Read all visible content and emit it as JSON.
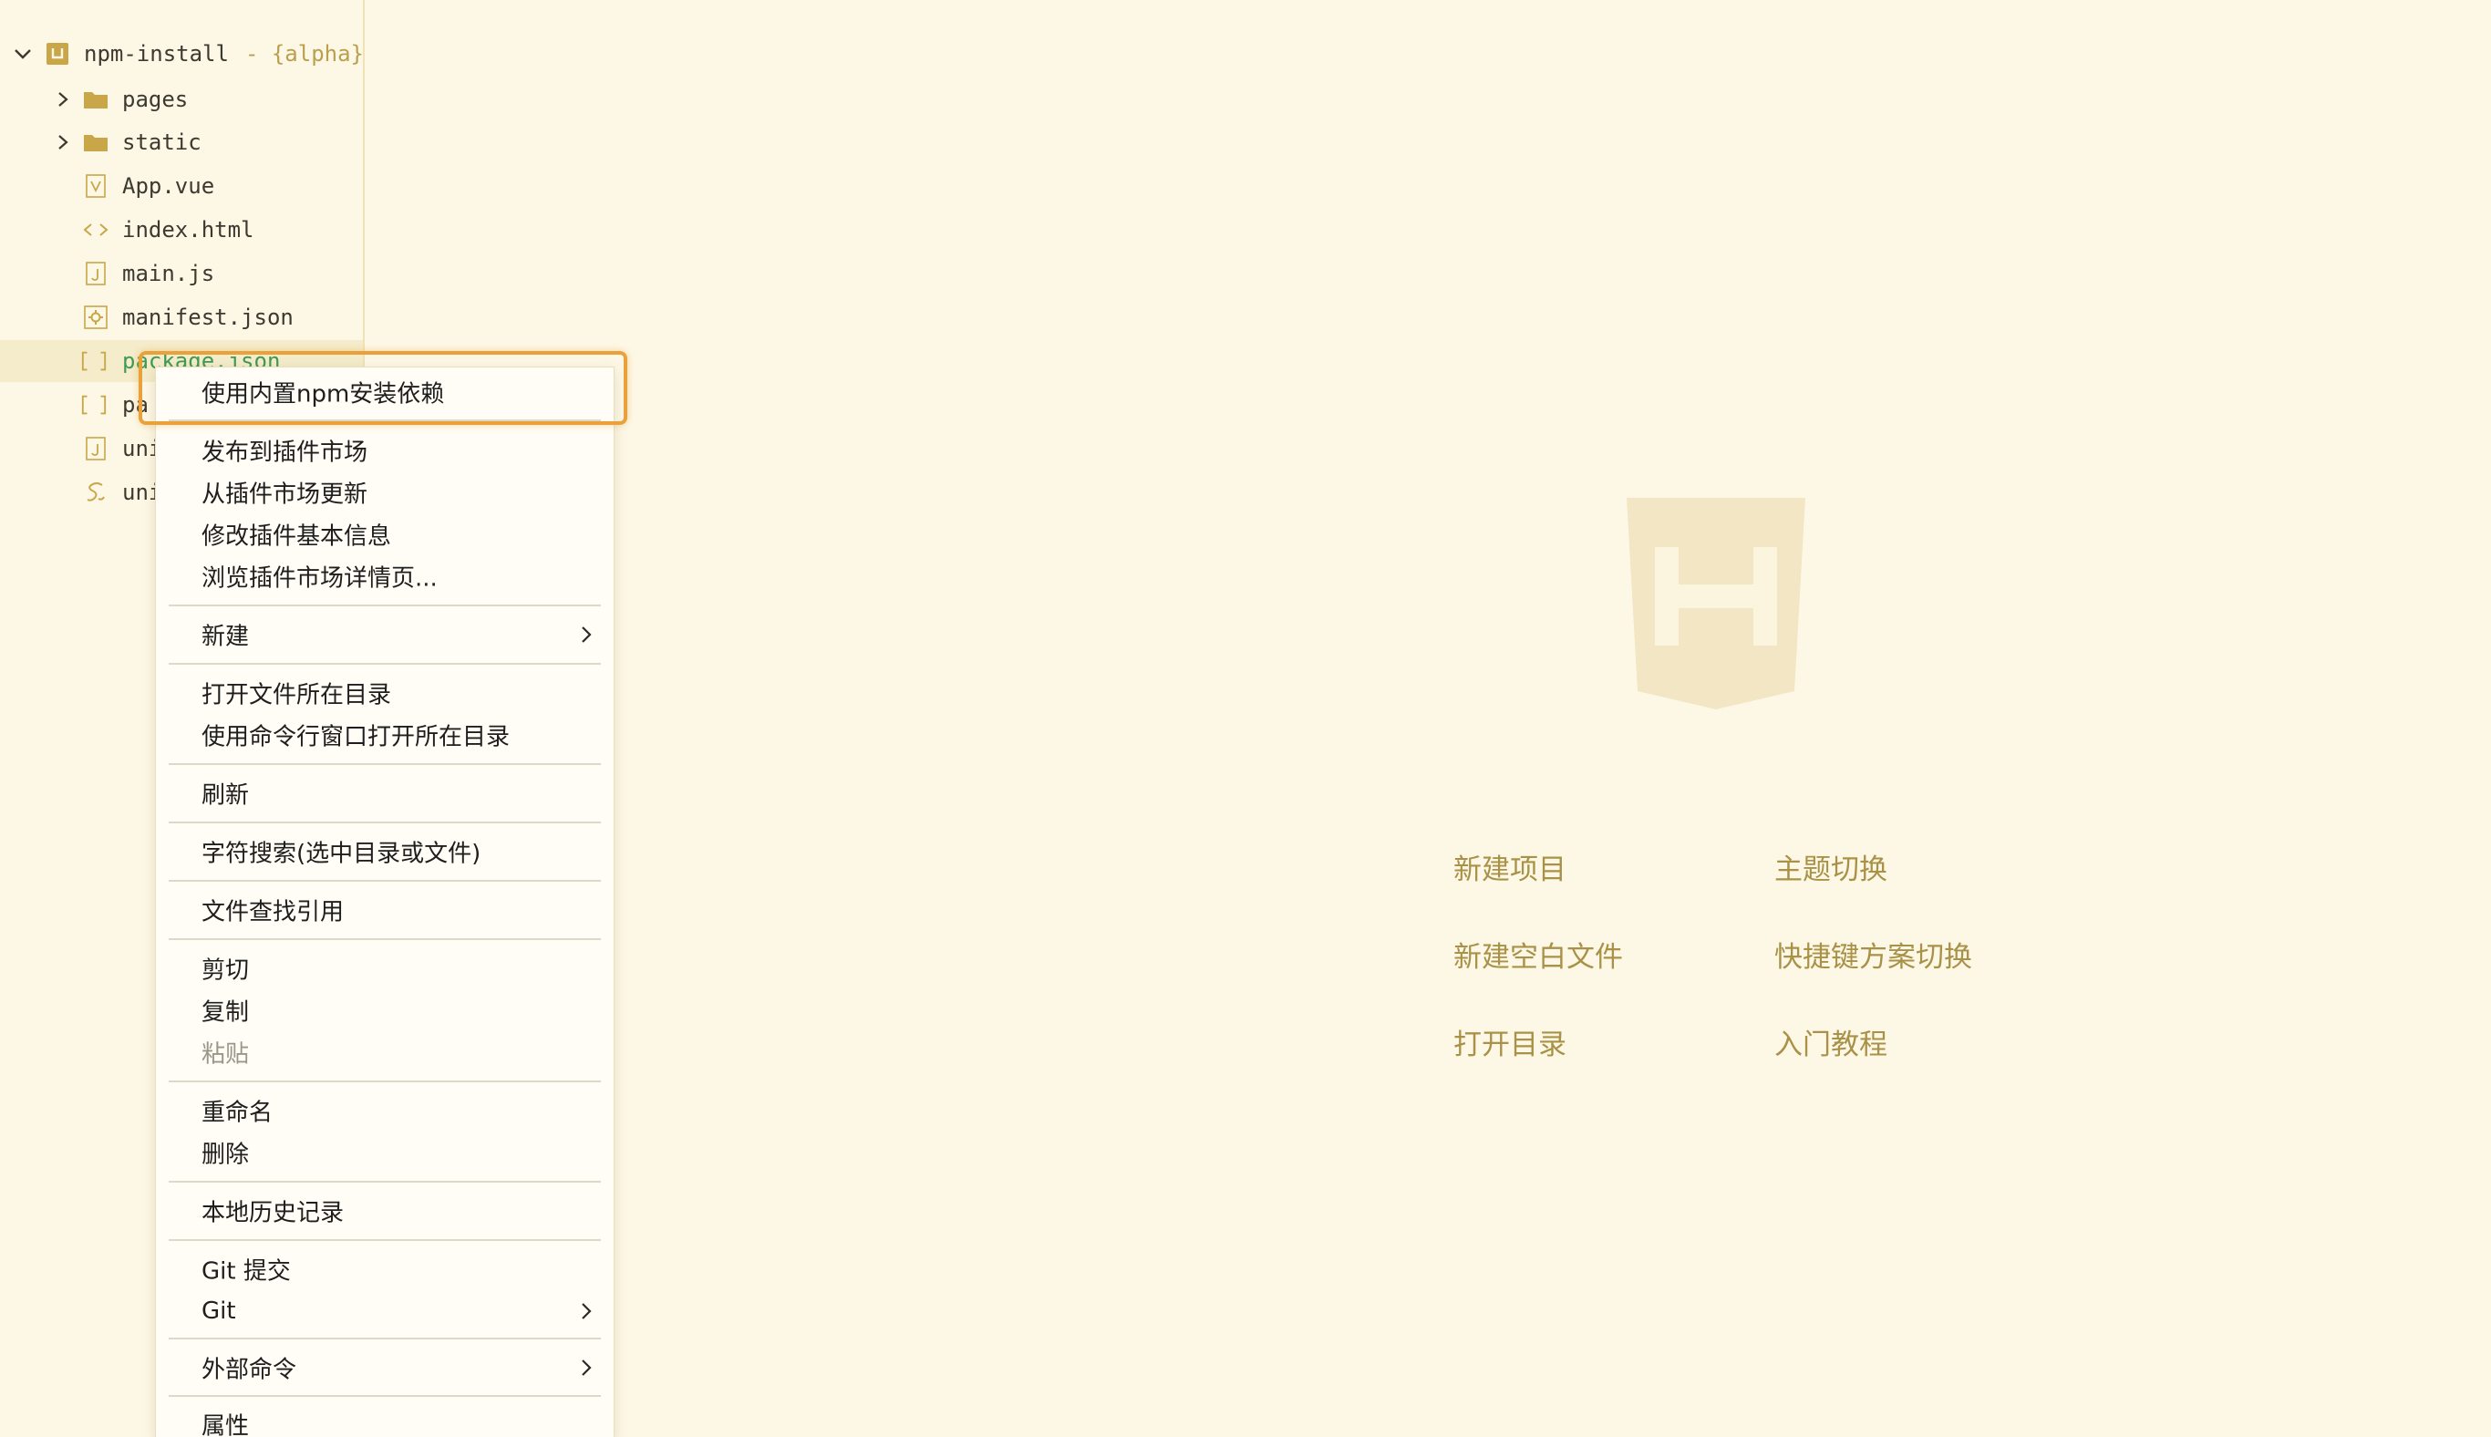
{
  "tree": {
    "root": {
      "name": "npm-install",
      "suffix": "- {alpha}",
      "expanded": true
    },
    "items": [
      {
        "name": "pages",
        "type": "folder",
        "expandable": true
      },
      {
        "name": "static",
        "type": "folder",
        "expandable": true
      },
      {
        "name": "App.vue",
        "type": "vue"
      },
      {
        "name": "index.html",
        "type": "html"
      },
      {
        "name": "main.js",
        "type": "js"
      },
      {
        "name": "manifest.json",
        "type": "manifest"
      },
      {
        "name": "package.json",
        "type": "json",
        "selected": true
      },
      {
        "name": "pa",
        "type": "json"
      },
      {
        "name": "uni",
        "type": "js"
      },
      {
        "name": "uni",
        "type": "scss"
      }
    ]
  },
  "welcome": {
    "actions": [
      {
        "label": "新建项目"
      },
      {
        "label": "主题切换"
      },
      {
        "label": "新建空白文件"
      },
      {
        "label": "快捷键方案切换"
      },
      {
        "label": "打开目录"
      },
      {
        "label": "入门教程"
      }
    ]
  },
  "context_menu": {
    "items": [
      {
        "label": "使用内置npm安装依赖",
        "highlighted": true
      },
      {
        "label": "发布到插件市场"
      },
      {
        "label": "从插件市场更新"
      },
      {
        "label": "修改插件基本信息"
      },
      {
        "label": "浏览插件市场详情页..."
      },
      {
        "label": "新建",
        "submenu": true
      },
      {
        "label": "打开文件所在目录"
      },
      {
        "label": "使用命令行窗口打开所在目录"
      },
      {
        "label": "刷新"
      },
      {
        "label": "字符搜索(选中目录或文件)"
      },
      {
        "label": "文件查找引用"
      },
      {
        "label": "剪切"
      },
      {
        "label": "复制"
      },
      {
        "label": "粘贴",
        "disabled": true
      },
      {
        "label": "重命名"
      },
      {
        "label": "删除"
      },
      {
        "label": "本地历史记录"
      },
      {
        "label": "Git 提交"
      },
      {
        "label": "Git",
        "submenu": true
      },
      {
        "label": "外部命令",
        "submenu": true
      },
      {
        "label": "属性"
      }
    ]
  },
  "colors": {
    "background": "#fdf8e6",
    "accent": "#a99247",
    "folder": "#c9a748",
    "selected_text": "#3f9a53",
    "highlight_border": "#e9a23b"
  }
}
